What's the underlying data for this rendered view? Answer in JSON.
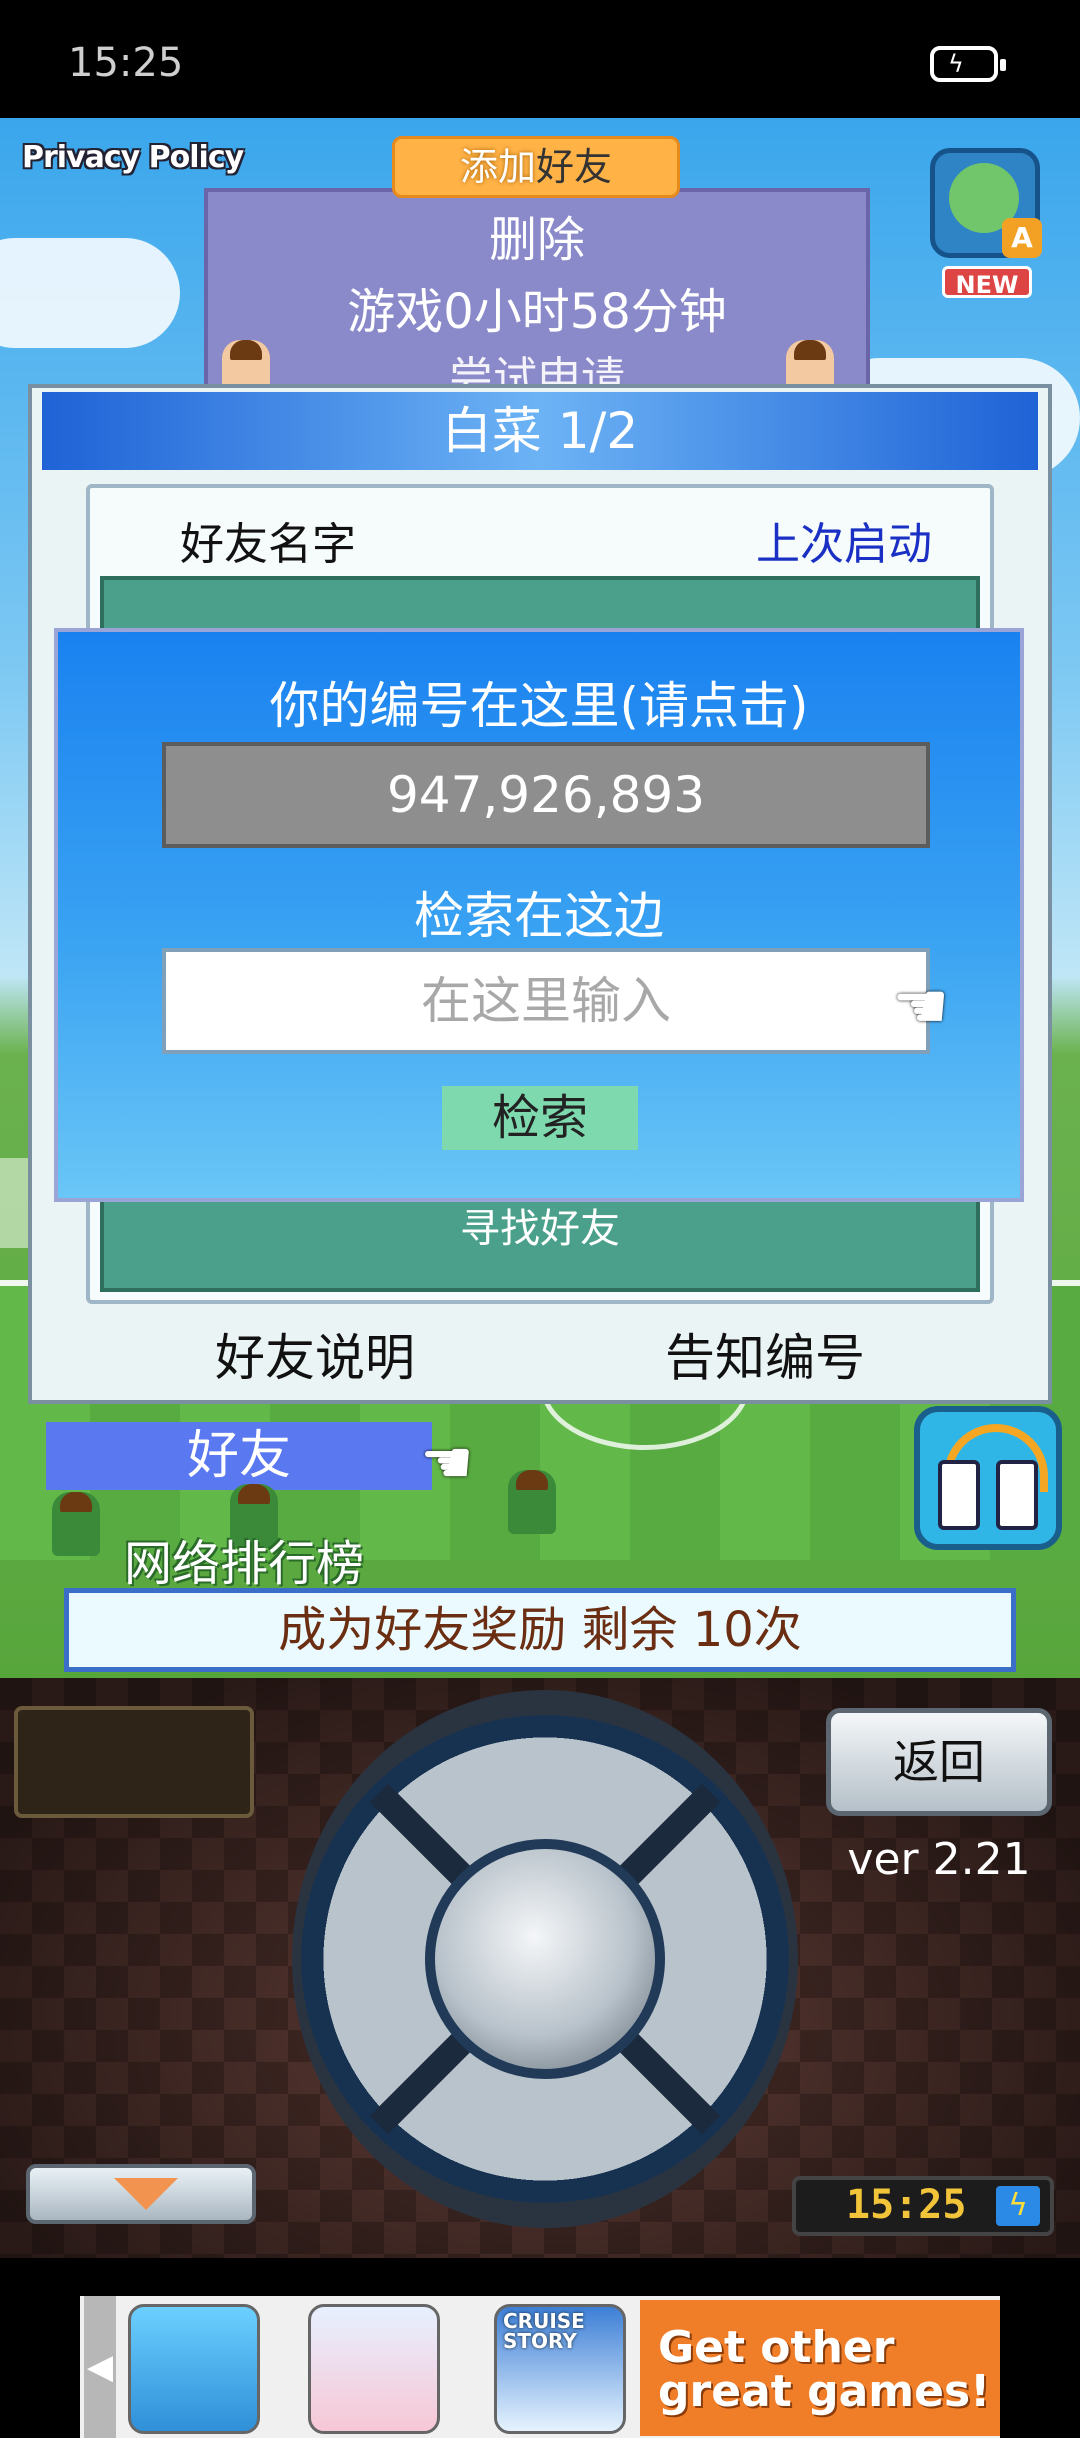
{
  "status_bar": {
    "time": "15:25"
  },
  "top": {
    "privacy_policy": "Privacy Policy",
    "add_friend_tab_prefix": "添加",
    "add_friend_tab_suffix": "好友",
    "translate_badge": "A",
    "translate_new": "NEW"
  },
  "background_panel": {
    "delete": "删除",
    "playtime": "游戏0小时58分钟",
    "apply": "尝试申请"
  },
  "friends_panel": {
    "title": "白菜 1/2",
    "col_friend_name": "好友名字",
    "col_last_launch": "上次启动",
    "find_friends": "寻找好友",
    "friend_explain": "好友说明",
    "notify_id": "告知编号"
  },
  "dialog": {
    "your_id_label": "你的编号在这里(请点击)",
    "your_id": "947,926,893",
    "search_label": "检索在这边",
    "search_placeholder": "在这里输入",
    "search_button": "检索"
  },
  "tabs": {
    "friends": "好友",
    "ranking": "网络排行榜"
  },
  "reward": "成为好友奖励 剩余 10次",
  "controller": {
    "back": "返回",
    "version": "ver 2.21",
    "clock": "15:25"
  },
  "ad": {
    "icon3_title": "CRUISE STORY",
    "cta_line1": "Get other",
    "cta_line2": "great games!"
  },
  "icons": [
    "battery-charging-icon",
    "translate-icon",
    "pointer-hand-icon",
    "swap-devices-icon",
    "chevron-down-icon",
    "arrow-left-icon"
  ]
}
